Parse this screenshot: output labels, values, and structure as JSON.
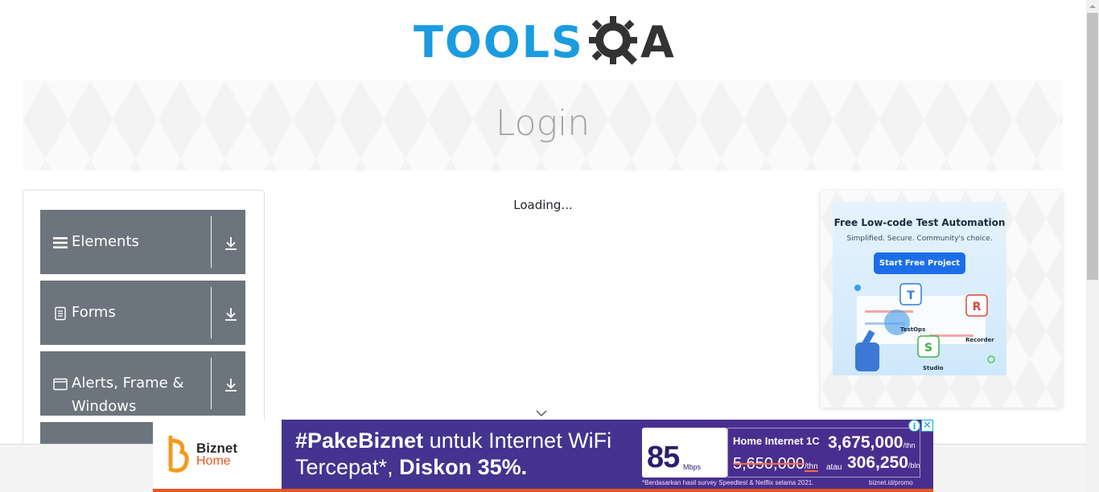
{
  "header": {
    "logo_text": "TOOLS",
    "logo_letter": "A"
  },
  "banner": {
    "title": "Login"
  },
  "sidebar": {
    "groups": [
      {
        "label": "Elements",
        "icon": "hamburger-icon"
      },
      {
        "label": "Forms",
        "icon": "document-icon"
      },
      {
        "label": "Alerts, Frame & Windows",
        "icon": "window-icon"
      }
    ]
  },
  "main": {
    "loading_text": "Loading..."
  },
  "ad_right": {
    "title": "Free Low-code Test Automation",
    "subtitle": "Simplified. Secure. Community's choice.",
    "button": "Start Free Project",
    "labels": [
      "TestOps",
      "Recorder",
      "Studio"
    ]
  },
  "ad_bottom": {
    "brand": "Biznet",
    "brand_sub": "Home",
    "headline_tag": "#PakeBiznet",
    "headline_rest": " untuk Internet WiFi",
    "headline2_a": "Tercepat*, ",
    "headline2_b": "Diskon 35%.",
    "speed": "85",
    "speed_unit": "Mbps",
    "plan_name": "Home Internet 1C",
    "price_year": "3,675,000",
    "per_year": "/thn",
    "old_price": "5,650,000",
    "old_per": "/thn",
    "atau": "atau",
    "price_month": "306,250",
    "per_month": "/bln",
    "disclaimer": "*Berdasarkan hasil survey Speedtest & Netflix selama 2021.",
    "link": "biznet.id/promo",
    "info_glyph": "i",
    "close_glyph": "✕"
  },
  "colors": {
    "brand_blue": "#1b9be0",
    "sidebar_gray": "#6c757d",
    "ad_purple": "#44338f",
    "ad_orange": "#e8571f"
  }
}
